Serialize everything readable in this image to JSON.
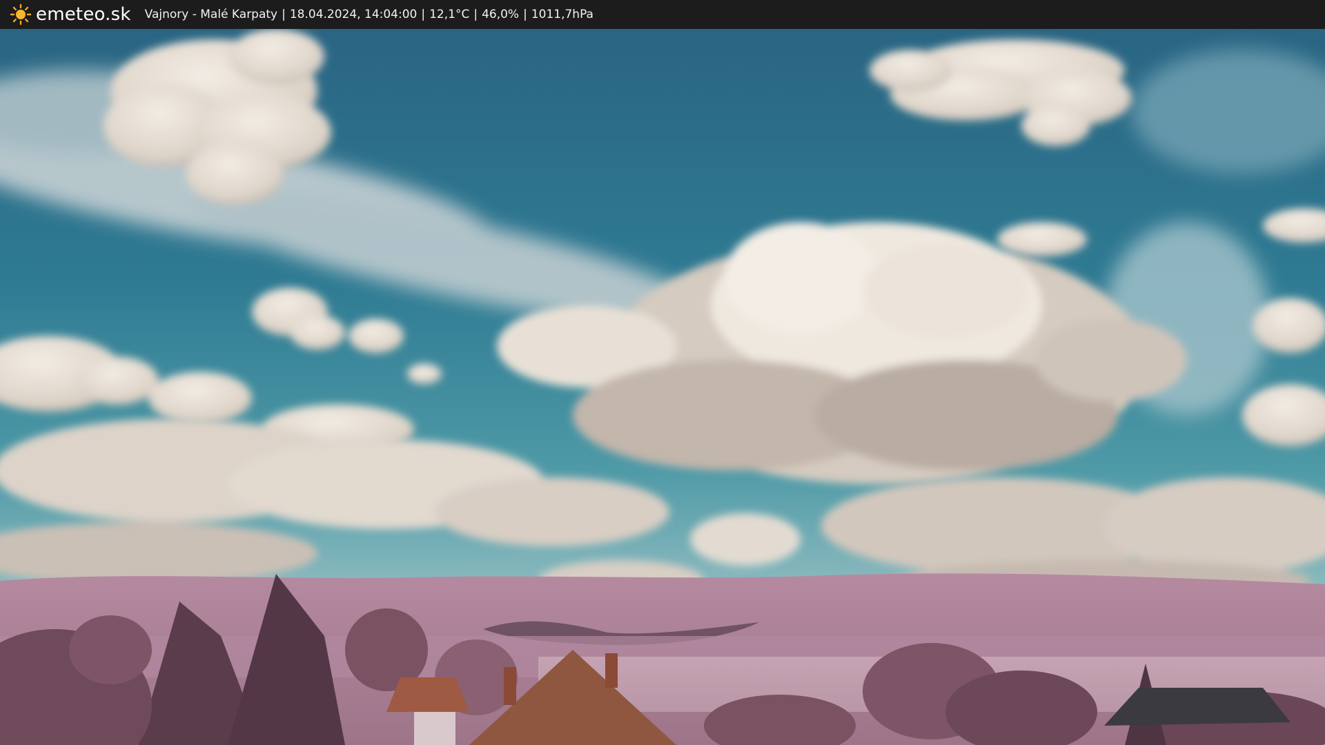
{
  "brand": {
    "name": "emeteo.sk",
    "icon": "sun-icon",
    "icon_color": "#f5a623"
  },
  "status": {
    "location": "Vajnory - Malé Karpaty",
    "datetime": "18.04.2024, 14:04:00",
    "temperature": "12,1°C",
    "humidity": "46,0%",
    "pressure": "1011,7hPa",
    "separator": "|"
  },
  "scene": {
    "sky_color": "#2f7892",
    "cloud_color": "#e9e2da",
    "hill_color": "#a87f95",
    "tree_color": "#6e4a5a",
    "roof_color": "#9e5a42"
  }
}
